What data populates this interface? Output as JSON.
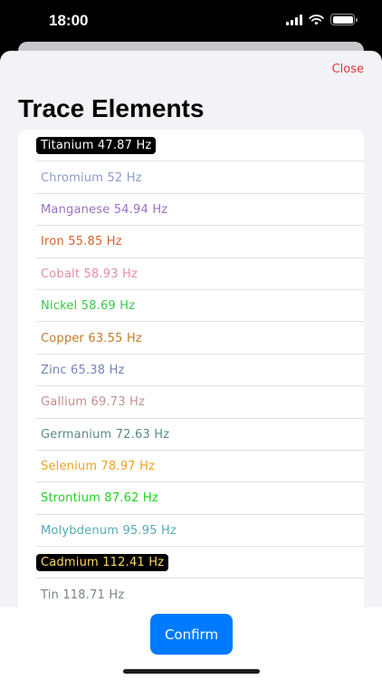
{
  "status_bar": {
    "time": "18:00"
  },
  "sheet": {
    "close_label": "Close",
    "title": "Trace Elements"
  },
  "elements": [
    {
      "label": "Titanium 47.87 Hz",
      "color": "#ffffff",
      "highlighted": true
    },
    {
      "label": "Chromium 52 Hz",
      "color": "#8b9cc9",
      "highlighted": false
    },
    {
      "label": "Manganese 54.94 Hz",
      "color": "#9b6fc2",
      "highlighted": false
    },
    {
      "label": "Iron 55.85 Hz",
      "color": "#d2632a",
      "highlighted": false
    },
    {
      "label": "Cobalt 58.93 Hz",
      "color": "#e58ea0",
      "highlighted": false
    },
    {
      "label": "Nickel 58.69 Hz",
      "color": "#3ec84a",
      "highlighted": false
    },
    {
      "label": "Copper 63.55 Hz",
      "color": "#c27b2e",
      "highlighted": false
    },
    {
      "label": "Zinc 65.38 Hz",
      "color": "#7582b8",
      "highlighted": false
    },
    {
      "label": "Gallium 69.73 Hz",
      "color": "#c48f8f",
      "highlighted": false
    },
    {
      "label": "Germanium 72.63 Hz",
      "color": "#5a8a8a",
      "highlighted": false
    },
    {
      "label": "Selenium 78.97 Hz",
      "color": "#f0a020",
      "highlighted": false
    },
    {
      "label": "Strontium 87.62 Hz",
      "color": "#22d022",
      "highlighted": false
    },
    {
      "label": "Molybdenum 95.95 Hz",
      "color": "#55aab5",
      "highlighted": false
    },
    {
      "label": "Cadmium 112.41 Hz",
      "color": "#ffd966",
      "highlighted": true
    },
    {
      "label": "Tin 118.71 Hz",
      "color": "#7a8585",
      "highlighted": false
    },
    {
      "label": "",
      "color": "#7a8585",
      "highlighted": false
    }
  ],
  "footer": {
    "confirm_label": "Confirm"
  },
  "colors": {
    "accent": "#007aff",
    "close": "#e0383e"
  }
}
